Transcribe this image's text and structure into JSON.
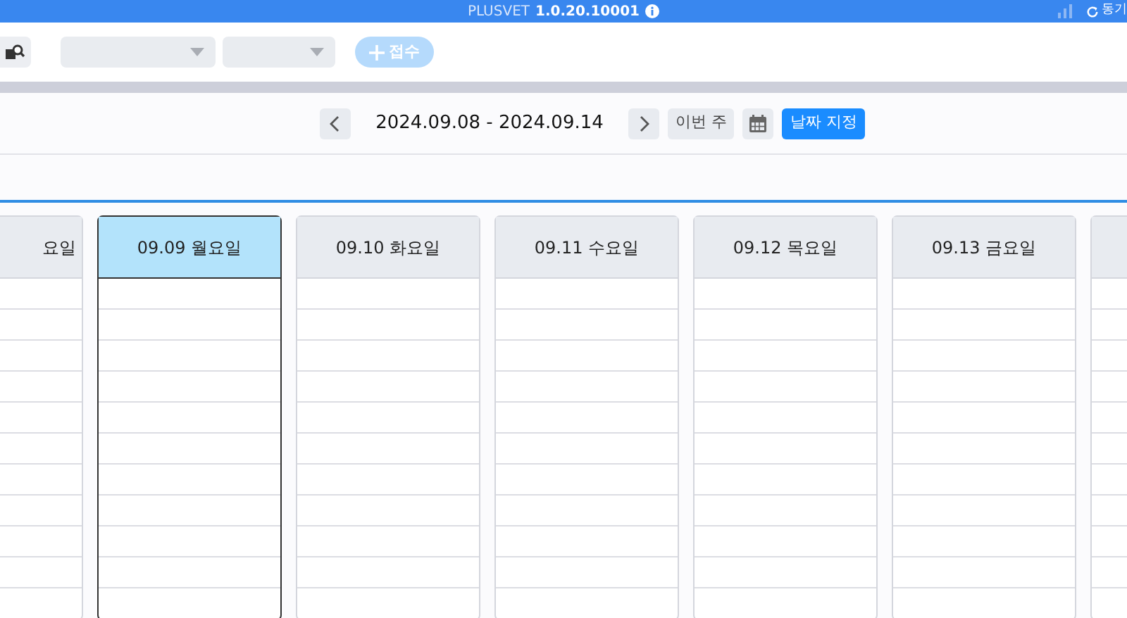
{
  "title_bar": {
    "app": "PLUSVET",
    "version": "1.0.20.10001",
    "sync": "동기"
  },
  "toolbar": {
    "dropdowns": [
      {
        "kind": "wide"
      },
      {
        "kind": "narrow"
      }
    ],
    "add_button": {
      "label": "접수",
      "disabled": true
    }
  },
  "week_nav": {
    "range": "2024.09.08 - 2024.09.14",
    "this_week": "이번 주",
    "pick_date": "날짜 지정"
  },
  "days": [
    {
      "label": "요일",
      "selected": false,
      "kind": "cut"
    },
    {
      "label": "09.09 월요일",
      "selected": true,
      "kind": "full"
    },
    {
      "label": "09.10 화요일",
      "selected": false,
      "kind": "full"
    },
    {
      "label": "09.11 수요일",
      "selected": false,
      "kind": "full"
    },
    {
      "label": "09.12 목요일",
      "selected": false,
      "kind": "full"
    },
    {
      "label": "09.13 금요일",
      "selected": false,
      "kind": "full"
    },
    {
      "selected": false,
      "kind": "edge"
    }
  ]
}
